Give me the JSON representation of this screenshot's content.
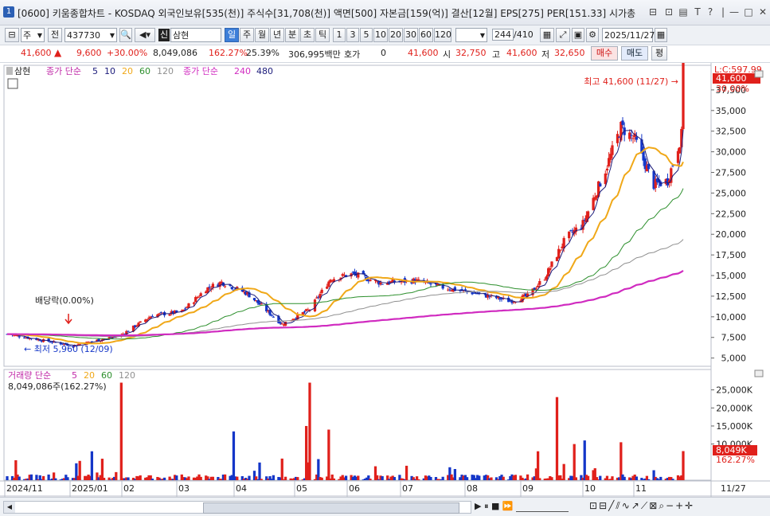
{
  "window": {
    "number": "1",
    "title": "[0600] 키움종합차트 - KOSDAQ 외국인보유[535(천)] 주식수[31,708(천)] 액면[500] 자본금[159(억)] 결산[12월] EPS[275] PER[151.33] 시가총",
    "controls": [
      "⊟",
      "⊡",
      "▤",
      "T",
      "?",
      "|",
      "—",
      "□",
      "✕"
    ]
  },
  "toolbar": {
    "period_main": "주",
    "whole_label": "전",
    "code": "437730",
    "name": "삼현",
    "badge": "신",
    "period_tabs": [
      "일",
      "주",
      "월",
      "년",
      "분",
      "초",
      "틱"
    ],
    "active_period": "일",
    "intervals": [
      "1",
      "3",
      "5",
      "10",
      "20",
      "30",
      "60",
      "120"
    ],
    "count": "244",
    "count_total": "/410",
    "date": "2025/11/27"
  },
  "quote": {
    "price": "41,600",
    "arrow": "▲",
    "change": "9,600",
    "change_pct": "+30.00%",
    "volume": "8,049,086",
    "volume_ratio": "162.27%",
    "turnover": "25.39%",
    "amount": "306,995백만",
    "hoga_label": "호가",
    "hoga_value": "0",
    "current": "41,600",
    "open_label": "시",
    "open": "32,750",
    "high_label": "고",
    "high": "41,600",
    "low_label": "저",
    "low": "32,650",
    "buy_btn": "매수",
    "sell_btn": "매도",
    "eval_btn": "평"
  },
  "price_pane": {
    "legend_name": "삼현",
    "legend_ma_label": "종가 단순",
    "legend_ma_periods": [
      "5",
      "10",
      "20",
      "60",
      "120"
    ],
    "legend_ma2_label": "종가 단순",
    "legend_ma2_periods": [
      "240",
      "480"
    ],
    "annotation_high": "최고 41,600 (11/27) →",
    "annotation_low": "← 최저 5,960 (12/09)",
    "annotation_dividend": "배당락(0.00%)",
    "right_top": "L:C:597.99",
    "current_tag": "41,600",
    "pct_tag": "30.00%",
    "y_ticks": [
      "37,500",
      "35,000",
      "32,500",
      "30,000",
      "27,500",
      "25,000",
      "22,500",
      "20,000",
      "17,500",
      "15,000",
      "12,500",
      "10,000",
      "7,500",
      "5,000"
    ]
  },
  "volume_pane": {
    "legend_label": "거래량 단순",
    "legend_periods": [
      "5",
      "20",
      "60",
      "120"
    ],
    "readout": "8,049,086주(162.27%)",
    "y_ticks": [
      "25,000K",
      "20,000K",
      "15,000K",
      "10,000K"
    ],
    "current_tag": "8,049K",
    "pct_tag": "162.27%"
  },
  "x_axis": {
    "labels": [
      "2024/11",
      "2025/01",
      "02",
      "03",
      "04",
      "05",
      "06",
      "07",
      "08",
      "09",
      "10",
      "11"
    ],
    "right_label": "11/27"
  },
  "colors": {
    "up": "#e0201b",
    "down": "#1436c8",
    "ma5": "#1a1a7a",
    "ma20": "#f0a818",
    "ma60": "#2c8f2c",
    "ma120": "#909090",
    "ma240": "#d02bc0"
  },
  "chart_data": {
    "type": "candlestick",
    "anchors": [
      [
        "2024-11-01",
        7900
      ],
      [
        "2024-12-09",
        6500
      ],
      [
        "2025-01-06",
        7800
      ],
      [
        "2025-01-24",
        10200
      ],
      [
        "2025-02-10",
        10600
      ],
      [
        "2025-02-24",
        13400
      ],
      [
        "2025-03-05",
        14200
      ],
      [
        "2025-03-20",
        12800
      ],
      [
        "2025-04-09",
        9100
      ],
      [
        "2025-04-25",
        10900
      ],
      [
        "2025-05-07",
        14600
      ],
      [
        "2025-05-20",
        15200
      ],
      [
        "2025-06-05",
        14100
      ],
      [
        "2025-06-25",
        14400
      ],
      [
        "2025-07-10",
        13600
      ],
      [
        "2025-07-31",
        12800
      ],
      [
        "2025-08-19",
        11900
      ],
      [
        "2025-08-29",
        12500
      ],
      [
        "2025-09-08",
        14800
      ],
      [
        "2025-09-20",
        19500
      ],
      [
        "2025-09-30",
        21300
      ],
      [
        "2025-10-13",
        27800
      ],
      [
        "2025-10-22",
        33000
      ],
      [
        "2025-10-30",
        31500
      ],
      [
        "2025-11-10",
        26000
      ],
      [
        "2025-11-18",
        26500
      ],
      [
        "2025-11-26",
        32000
      ],
      [
        "2025-11-27",
        41600
      ]
    ],
    "y_range": [
      4000,
      40000
    ],
    "volume_range_k": [
      0,
      28000
    ],
    "volume_spikes_k": [
      [
        "2024-12-20",
        8000
      ],
      [
        "2025-01-06",
        27000
      ],
      [
        "2025-03-12",
        13500
      ],
      [
        "2025-04-23",
        15000
      ],
      [
        "2025-04-25",
        27000
      ],
      [
        "2025-05-06",
        14000
      ],
      [
        "2025-09-04",
        8000
      ],
      [
        "2025-09-15",
        23000
      ],
      [
        "2025-09-25",
        10000
      ],
      [
        "2025-10-01",
        11000
      ],
      [
        "2025-10-22",
        10500
      ],
      [
        "2025-11-27",
        8049
      ]
    ]
  }
}
